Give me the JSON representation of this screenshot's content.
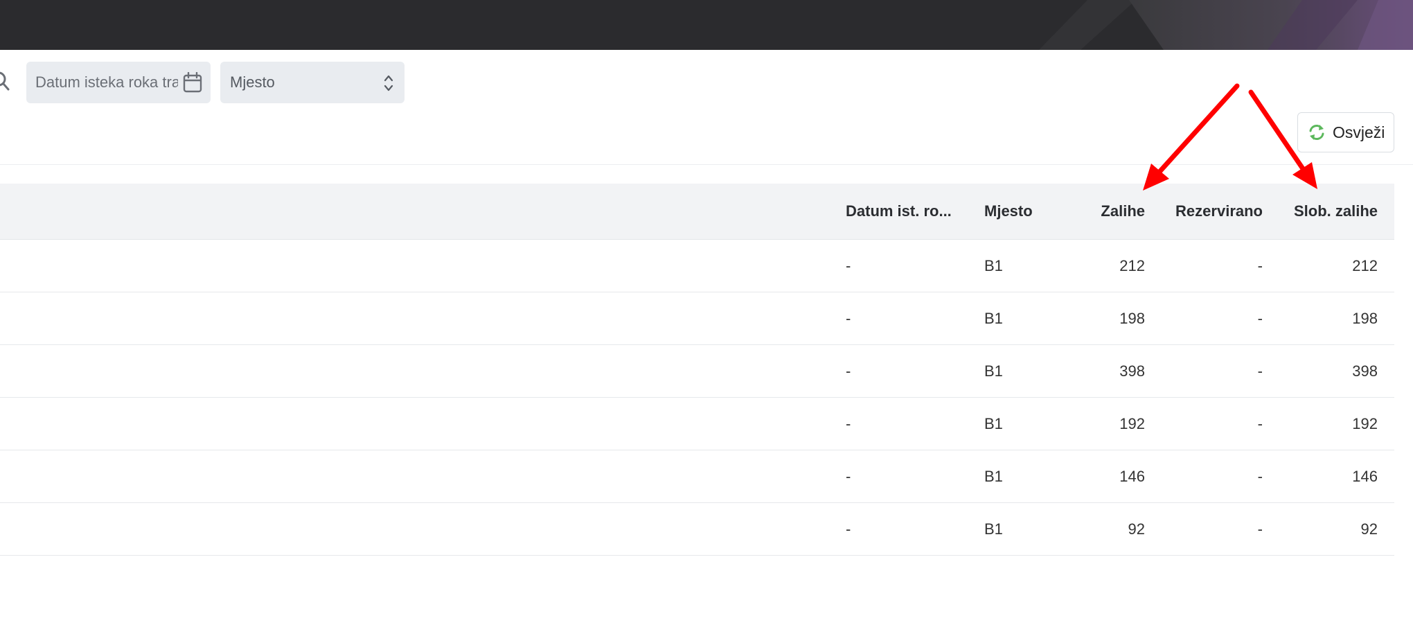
{
  "filters": {
    "expiry_date_placeholder": "Datum isteka roka trajanja",
    "location_value": "Mjesto"
  },
  "toolbar": {
    "refresh_label": "Osvježi"
  },
  "table": {
    "columns": [
      "Datum ist. ro...",
      "Mjesto",
      "Zalihe",
      "Rezervirano",
      "Slob. zalihe"
    ],
    "rows": [
      {
        "date": "-",
        "place": "B1",
        "stock": "212",
        "reserved": "-",
        "free": "212"
      },
      {
        "date": "-",
        "place": "B1",
        "stock": "198",
        "reserved": "-",
        "free": "198"
      },
      {
        "date": "-",
        "place": "B1",
        "stock": "398",
        "reserved": "-",
        "free": "398"
      },
      {
        "date": "-",
        "place": "B1",
        "stock": "192",
        "reserved": "-",
        "free": "192"
      },
      {
        "date": "-",
        "place": "B1",
        "stock": "146",
        "reserved": "-",
        "free": "146"
      },
      {
        "date": "-",
        "place": "B1",
        "stock": "92",
        "reserved": "-",
        "free": "92"
      }
    ]
  },
  "colors": {
    "header_bg": "#2b2b2e",
    "accent_purple": "#5a3a6a",
    "refresh_icon": "#5cb85c",
    "annotation_arrow": "#ff0000"
  }
}
